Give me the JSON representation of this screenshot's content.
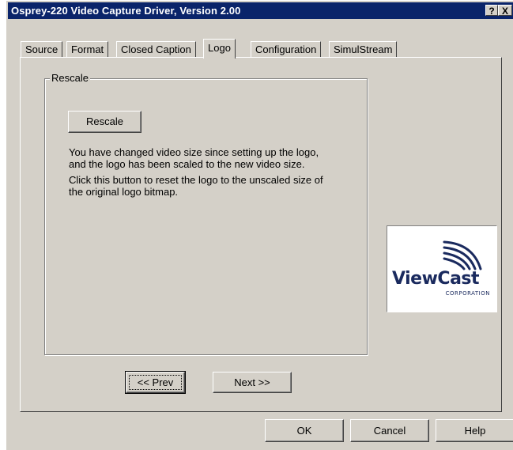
{
  "window": {
    "title": "Osprey-220 Video Capture Driver, Version 2.00",
    "help_glyph": "?",
    "close_glyph": "X"
  },
  "tabs": [
    {
      "label": "Source"
    },
    {
      "label": "Format"
    },
    {
      "label": "Closed Caption"
    },
    {
      "label": "Logo"
    },
    {
      "label": "Configuration"
    },
    {
      "label": "SimulStream"
    }
  ],
  "active_tab": "Logo",
  "rescale_group": {
    "legend": "Rescale",
    "button_label": "Rescale",
    "paragraph1_line1": "You have changed video size since setting up the logo,",
    "paragraph1_line2": "and the logo has been scaled to the new video size.",
    "paragraph2_line1": "Click this button to reset the logo to the unscaled size of",
    "paragraph2_line2": "the original logo bitmap."
  },
  "logo": {
    "brand": "ViewCast",
    "subtitle": "CORPORATION",
    "color": "#1a2a5e"
  },
  "nav": {
    "prev_label": "<< Prev",
    "next_label": "Next >>"
  },
  "footer": {
    "ok_label": "OK",
    "cancel_label": "Cancel",
    "help_label": "Help"
  },
  "colors": {
    "titlebar": "#0a246a",
    "face": "#d4d0c8"
  }
}
